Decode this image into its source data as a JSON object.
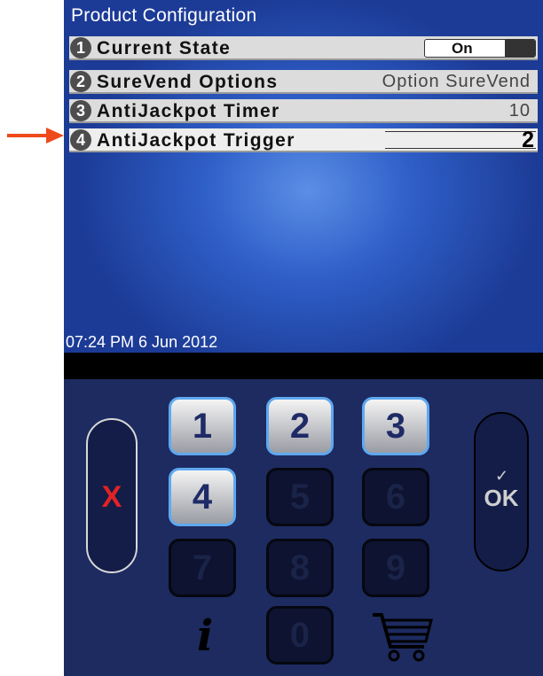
{
  "screen": {
    "title": "Product Configuration",
    "timestamp": "07:24 PM 6 Jun 2012"
  },
  "rows": [
    {
      "number": "1",
      "label": "Current State",
      "toggle_label": "On"
    },
    {
      "number": "2",
      "label": "SureVend Options",
      "value": "Option SureVend"
    },
    {
      "number": "3",
      "label": "AntiJackpot Timer",
      "value": "10"
    },
    {
      "number": "4",
      "label": "AntiJackpot Trigger",
      "value": "2"
    }
  ],
  "keypad": {
    "cancel_symbol": "X",
    "ok_check": "✓",
    "ok_label": "OK",
    "keys": [
      "1",
      "2",
      "3",
      "4",
      "5",
      "6",
      "7",
      "8",
      "9",
      "0"
    ],
    "info_symbol": "i"
  },
  "colors": {
    "pointer_arrow": "#ee4a1c",
    "cancel_x": "#e22323"
  }
}
